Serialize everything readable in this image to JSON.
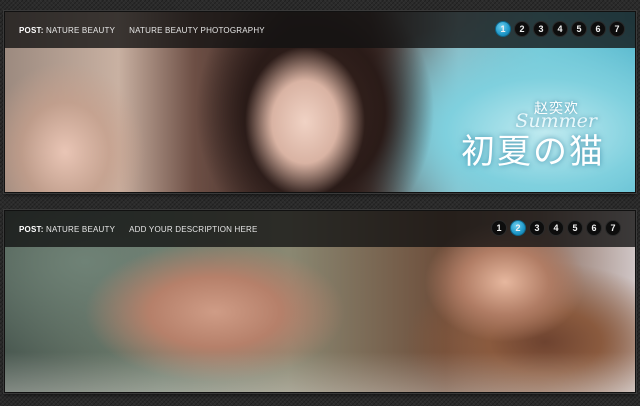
{
  "sliders": [
    {
      "post_prefix": "POST:",
      "post_title": "NATURE BEAUTY",
      "description": "NATURE BEAUTY PHOTOGRAPHY",
      "pages": [
        "1",
        "2",
        "3",
        "4",
        "5",
        "6",
        "7"
      ],
      "active_page": 1,
      "caption": {
        "signature": "赵奕欢",
        "script": "Summer",
        "main": "初夏の猫"
      }
    },
    {
      "post_prefix": "POST:",
      "post_title": "NATURE BEAUTY",
      "description": "ADD YOUR DESCRIPTION HERE",
      "pages": [
        "1",
        "2",
        "3",
        "4",
        "5",
        "6",
        "7"
      ],
      "active_page": 2
    }
  ],
  "colors": {
    "active_dot": "#1f98c9",
    "bar_bg": "#121212"
  }
}
